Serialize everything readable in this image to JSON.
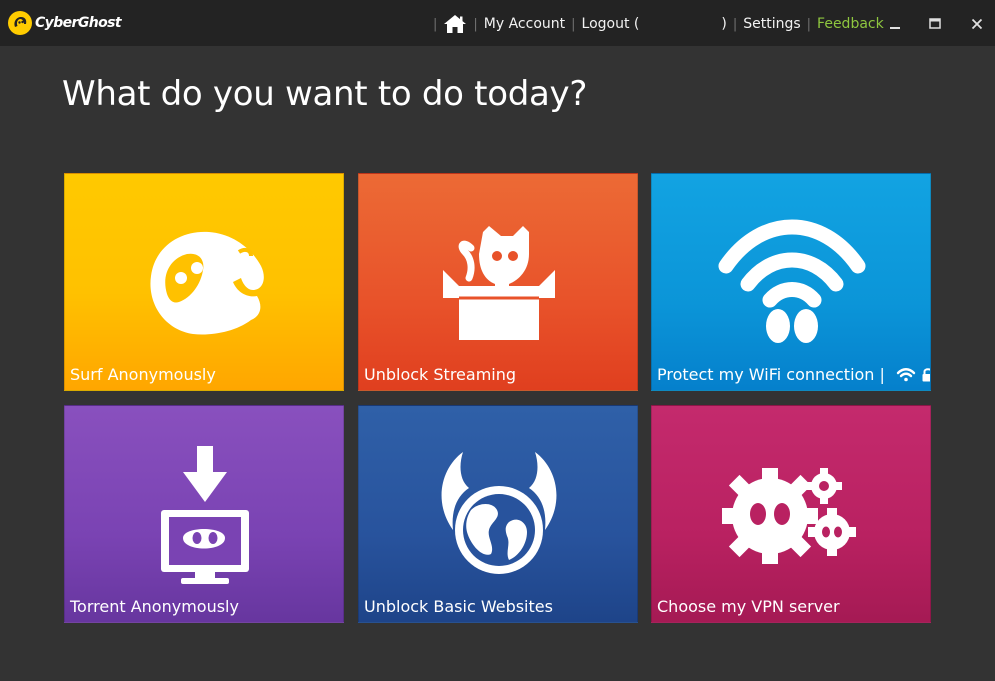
{
  "app": {
    "logo_text": "CyberGhost",
    "brand_color": "#ffcc00"
  },
  "nav": {
    "home_icon": "home-icon",
    "my_account": "My Account",
    "logout_open": "Logout (",
    "logout_close": ")",
    "settings": "Settings",
    "feedback": "Feedback",
    "feedback_color": "#8ec63f",
    "separator": "|"
  },
  "window_controls": {
    "minimize_icon": "minimize-icon",
    "maximize_icon": "maximize-icon",
    "close_icon": "close-icon"
  },
  "main": {
    "heading": "What do you want to do today?"
  },
  "tiles": [
    {
      "label": "Surf Anonymously",
      "icon": "ghost-icon",
      "color": "#ffc100"
    },
    {
      "label": "Unblock Streaming",
      "icon": "cat-in-box-icon",
      "color": "#e8522a"
    },
    {
      "label": "Protect my WiFi connection |",
      "icon": "wifi-ghost-icon",
      "color": "#0b95d8"
    },
    {
      "label": "Torrent Anonymously",
      "icon": "download-monitor-icon",
      "color": "#7a43b3"
    },
    {
      "label": "Unblock Basic Websites",
      "icon": "winged-globe-icon",
      "color": "#28539d"
    },
    {
      "label": "Choose my VPN server",
      "icon": "gears-icon",
      "color": "#b92161"
    }
  ]
}
